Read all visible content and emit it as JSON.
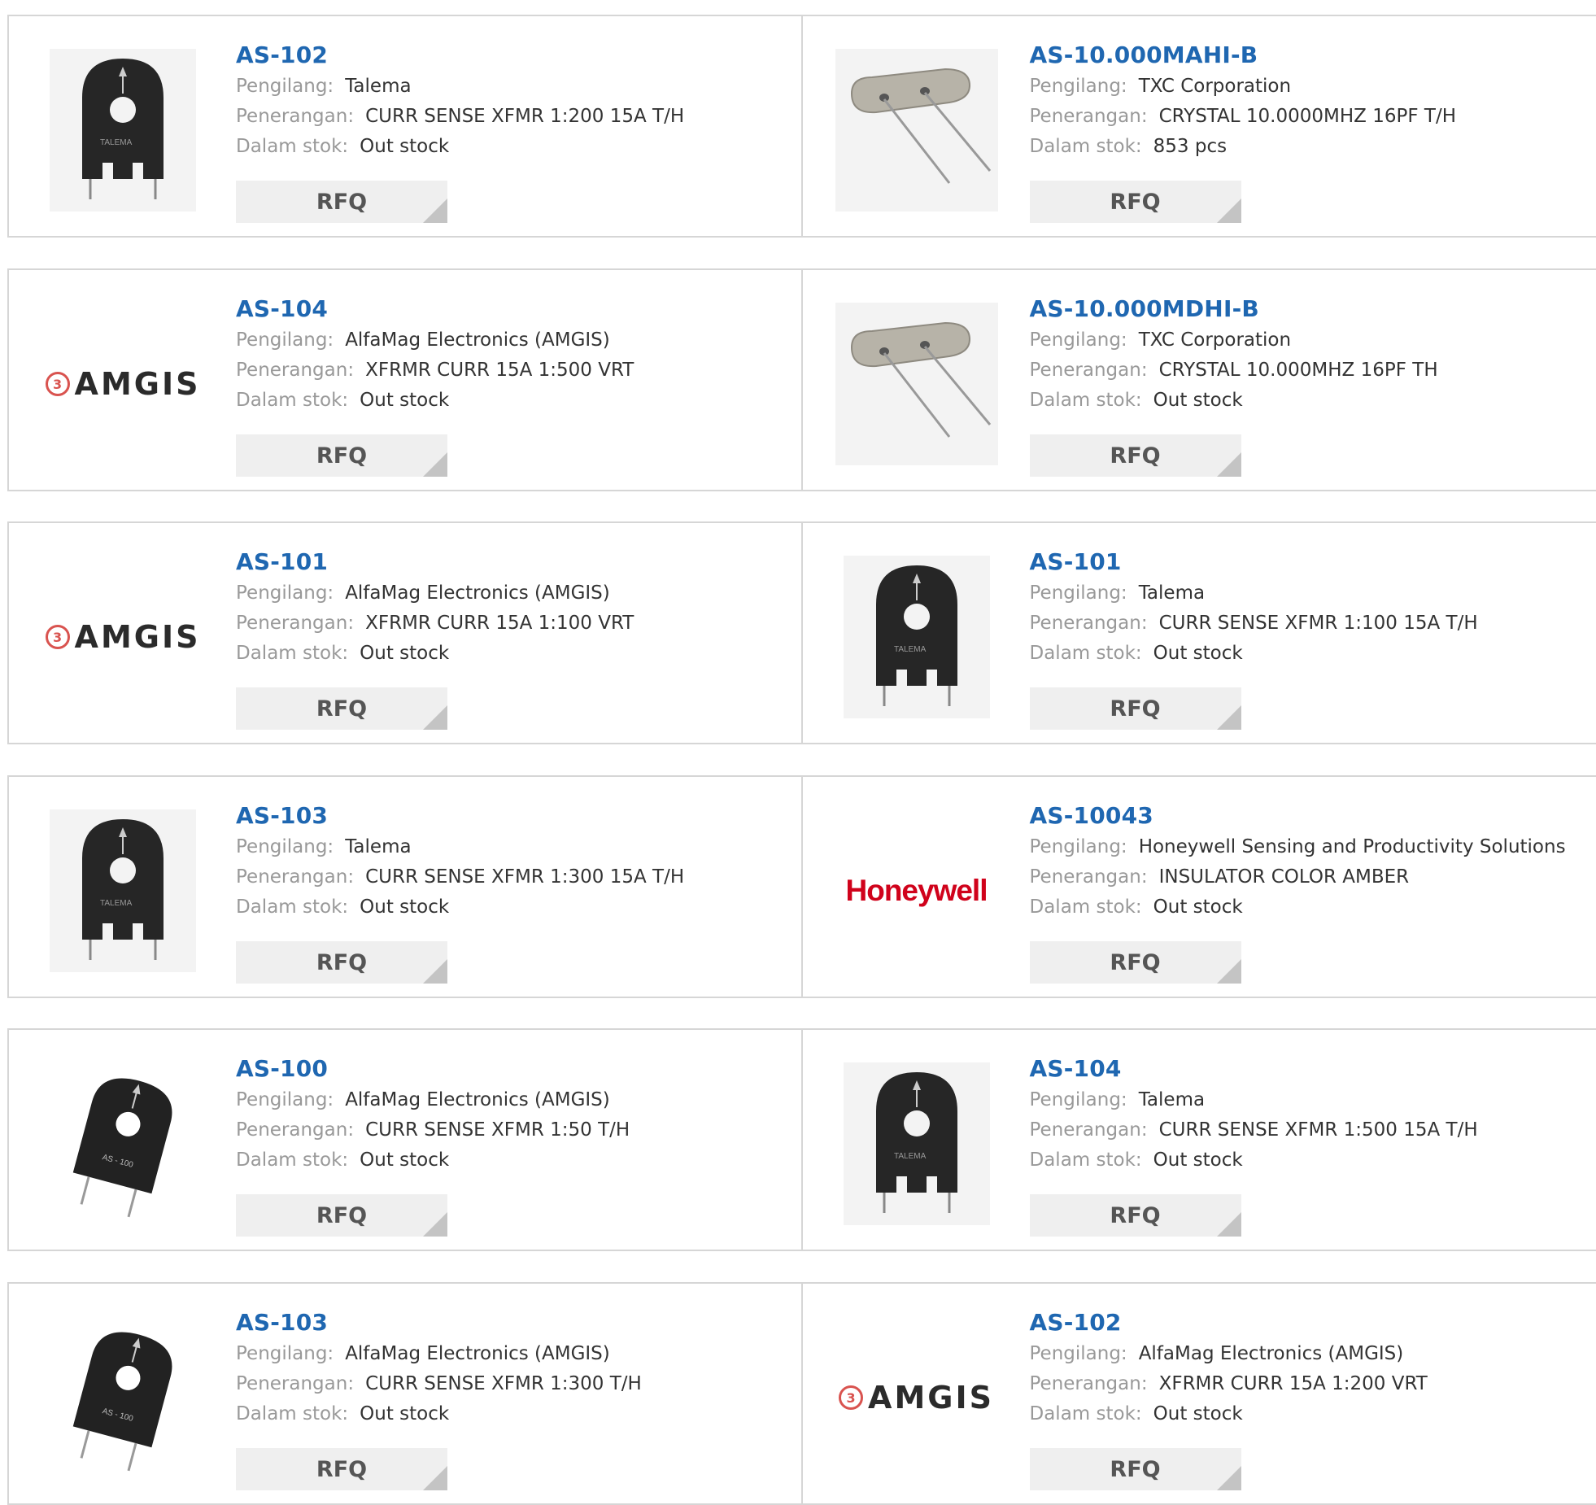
{
  "labels": {
    "manufacturer": "Pengilang:",
    "description": "Penerangan:",
    "stock": "Dalam stok:",
    "rfq": "RFQ"
  },
  "rows": [
    [
      {
        "part": "AS-102",
        "manufacturer": "Talema",
        "description": "CURR SENSE XFMR 1:200 15A T/H",
        "stock": "Out stock",
        "image": "talema-transformer"
      },
      {
        "part": "AS-10.000MAHI-B",
        "manufacturer": "TXC Corporation",
        "description": "CRYSTAL 10.0000MHZ 16PF T/H",
        "stock": "853 pcs",
        "image": "crystal"
      }
    ],
    [
      {
        "part": "AS-104",
        "manufacturer": "AlfaMag Electronics (AMGIS)",
        "description": "XFRMR CURR 15A 1:500 VRT",
        "stock": "Out stock",
        "image": "amgis-logo",
        "logo_text": "AMGIS"
      },
      {
        "part": "AS-10.000MDHI-B",
        "manufacturer": "TXC Corporation",
        "description": "CRYSTAL 10.000MHZ 16PF TH",
        "stock": "Out stock",
        "image": "crystal"
      }
    ],
    [
      {
        "part": "AS-101",
        "manufacturer": "AlfaMag Electronics (AMGIS)",
        "description": "XFRMR CURR 15A 1:100 VRT",
        "stock": "Out stock",
        "image": "amgis-logo",
        "logo_text": "AMGIS"
      },
      {
        "part": "AS-101",
        "manufacturer": "Talema",
        "description": "CURR SENSE XFMR 1:100 15A T/H",
        "stock": "Out stock",
        "image": "talema-transformer"
      }
    ],
    [
      {
        "part": "AS-103",
        "manufacturer": "Talema",
        "description": "CURR SENSE XFMR 1:300 15A T/H",
        "stock": "Out stock",
        "image": "talema-transformer"
      },
      {
        "part": "AS-10043",
        "manufacturer": "Honeywell Sensing and Productivity Solutions",
        "description": "INSULATOR COLOR AMBER",
        "stock": "Out stock",
        "image": "honeywell-logo",
        "logo_text": "Honeywell"
      }
    ],
    [
      {
        "part": "AS-100",
        "manufacturer": "AlfaMag Electronics (AMGIS)",
        "description": "CURR SENSE XFMR 1:50 T/H",
        "stock": "Out stock",
        "image": "amgis-transformer"
      },
      {
        "part": "AS-104",
        "manufacturer": "Talema",
        "description": "CURR SENSE XFMR 1:500 15A T/H",
        "stock": "Out stock",
        "image": "talema-transformer"
      }
    ],
    [
      {
        "part": "AS-103",
        "manufacturer": "AlfaMag Electronics (AMGIS)",
        "description": "CURR SENSE XFMR 1:300 T/H",
        "stock": "Out stock",
        "image": "amgis-transformer"
      },
      {
        "part": "AS-102",
        "manufacturer": "AlfaMag Electronics (AMGIS)",
        "description": "XFRMR CURR 15A 1:200 VRT",
        "stock": "Out stock",
        "image": "amgis-logo",
        "logo_text": "AMGIS"
      }
    ]
  ],
  "colors": {
    "link": "#1f67b1",
    "label": "#999999",
    "border": "#d6d6d6",
    "button": "#efefef"
  }
}
